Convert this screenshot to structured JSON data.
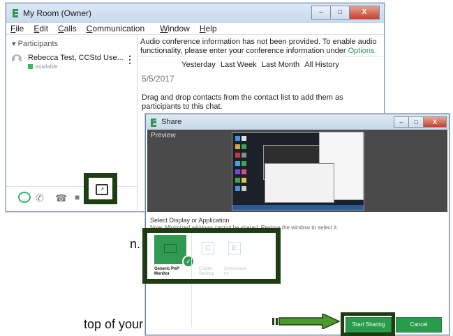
{
  "background_text": {
    "fragment_n": "n.",
    "fragment_top": "top of your"
  },
  "main_window": {
    "title": "My Room (Owner)",
    "controls": {
      "minimize": "–",
      "maximize": "□",
      "close": "X"
    },
    "menu": [
      "File",
      "Edit",
      "Calls",
      "Communication",
      "Window",
      "Help"
    ],
    "participants_header": "▾ Participants",
    "participant": {
      "name": "Rebecca Test, CCStd Use...",
      "status": "available",
      "more": "⋮"
    },
    "notice": {
      "text": "Audio conference information has not been provided. To enable audio functionality, please enter your conference information under",
      "link": "Options."
    },
    "history_filters": [
      "Yesterday",
      "Last Week",
      "Last Month",
      "All History"
    ],
    "date": "5/5/2017",
    "drag_drop_hint": "Drag and drop contacts from the contact list to add them as participants to this chat.",
    "footer_icons": [
      "chat-icon",
      "phone-icon",
      "desk-phone-icon",
      "video-icon",
      "screen-share-icon"
    ]
  },
  "share_dialog": {
    "title": "Share",
    "preview_label": "Preview",
    "select_label": "Select Display or Application",
    "hint": "Note: Minimized windows cannot be shared. Restore the window to select it.",
    "tiles": [
      {
        "label_line1": "Generic PnP",
        "label_line2": "Monitor",
        "selected": true
      },
      {
        "label_line1": "Chatter",
        "label_line2": "Desktop",
        "selected": false
      },
      {
        "label_line1": "Communica",
        "label_line2": "tor",
        "selected": false
      }
    ],
    "buttons": {
      "start": "Start Sharing",
      "cancel": "Cancel"
    }
  },
  "colors": {
    "accent_green": "#2a9b4b",
    "highlight_box": "#1e3d12",
    "arrow_green": "#4c9a2a"
  }
}
